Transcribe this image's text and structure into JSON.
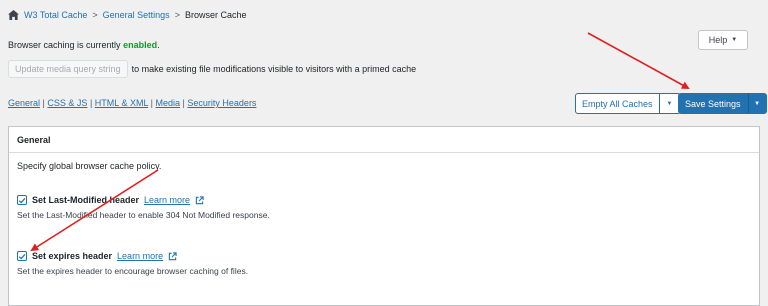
{
  "breadcrumb": {
    "items": [
      "W3 Total Cache",
      "General Settings",
      "Browser Cache"
    ],
    "separator": ">"
  },
  "status": {
    "prefix": "Browser caching is currently",
    "value": "enabled",
    "suffix": ".",
    "value_color": "#00a32a"
  },
  "help": {
    "label": "Help",
    "caret": "▼"
  },
  "update": {
    "button_label": "Update media query string",
    "description": "to make existing file modifications visible to visitors with a primed cache"
  },
  "subnav": {
    "items": [
      "General",
      "CSS & JS",
      "HTML & XML",
      "Media",
      "Security Headers"
    ],
    "separator": "|"
  },
  "actions": {
    "empty_caches_label": "Empty All Caches",
    "save_settings_label": "Save Settings",
    "caret": "▼",
    "accent_color": "#2271b1"
  },
  "panel": {
    "title": "General",
    "description": "Specify global browser cache policy.",
    "options": [
      {
        "label": "Set Last-Modified header",
        "link": "Learn more",
        "checked": true,
        "help": "Set the Last-Modified header to enable 304 Not Modified response."
      },
      {
        "label": "Set expires header",
        "link": "Learn more",
        "checked": true,
        "help": "Set the expires header to encourage browser caching of files."
      }
    ]
  },
  "annotations": {
    "arrow_color": "#e02020"
  }
}
